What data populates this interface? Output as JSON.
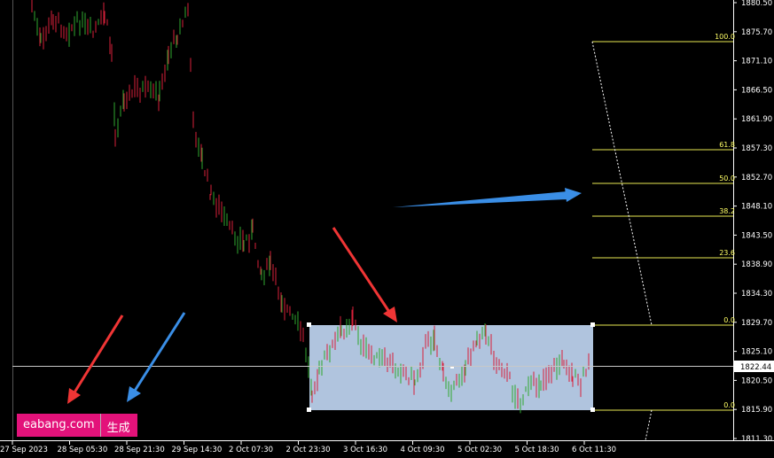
{
  "colors": {
    "background": "#000000",
    "candle_bull": "#2fa82f",
    "candle_bear": "#d8203a",
    "fib_line": "#e8e852",
    "fib_label": "#ffff66",
    "range_box": "#b0c4de",
    "red_arrow": "#f03535",
    "blue_arrow": "#3a8ee6",
    "badge": "#e3127a"
  },
  "price_axis": {
    "ticks": [
      "1880.50",
      "1875.70",
      "1871.10",
      "1866.50",
      "1861.90",
      "1857.30",
      "1852.70",
      "1848.10",
      "1843.50",
      "1838.90",
      "1834.30",
      "1829.70",
      "1825.10",
      "1820.50",
      "1815.90",
      "1811.30"
    ],
    "current_price": "1822.44"
  },
  "time_axis": {
    "labels": [
      "27 Sep 2023",
      "28 Sep 05:30",
      "28 Sep 21:30",
      "29 Sep 14:30",
      "2 Oct 07:30",
      "2 Oct 23:30",
      "3 Oct 16:30",
      "4 Oct 09:30",
      "5 Oct 02:30",
      "5 Oct 18:30",
      "6 Oct 11:30"
    ]
  },
  "fibonacci": {
    "levels": [
      "100.0",
      "61.8",
      "50.0",
      "38.2",
      "23.6",
      "0.0"
    ],
    "box_level": "0.0"
  },
  "badge": {
    "site": "eabang.com",
    "suffix": "生成"
  }
}
